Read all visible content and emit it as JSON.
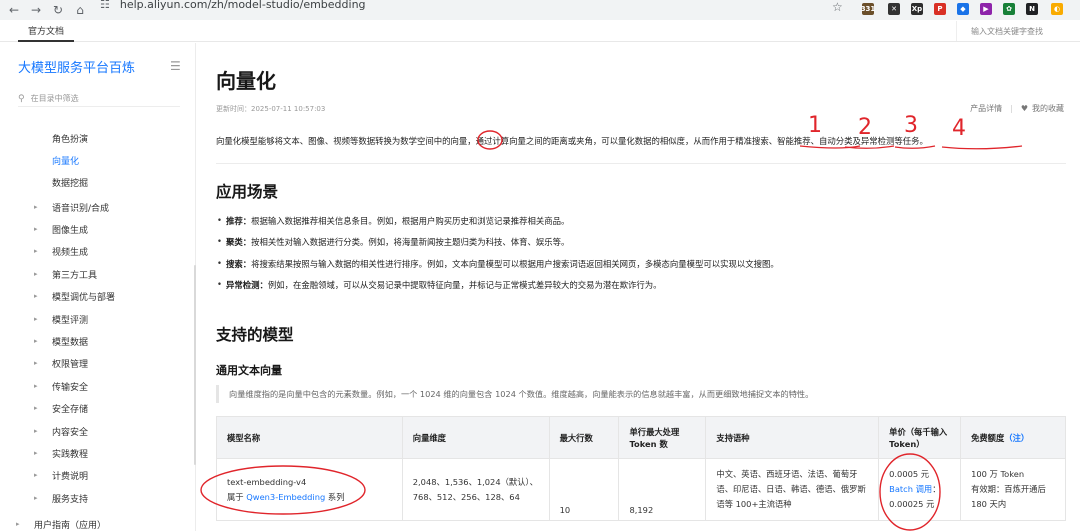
{
  "browser": {
    "url": "help.aliyun.com/zh/model-studio/embedding",
    "ext_badge": "331",
    "extensions": [
      {
        "label": "331",
        "color": "#6b4f2a"
      },
      {
        "label": "✕",
        "color": "#333333"
      },
      {
        "label": "Xp",
        "color": "#2d2d2d"
      },
      {
        "label": "P",
        "color": "#d93025"
      },
      {
        "label": "◆",
        "color": "#1a73e8"
      },
      {
        "label": "▶",
        "color": "#8e24aa"
      },
      {
        "label": "✿",
        "color": "#188038"
      },
      {
        "label": "N",
        "color": "#202124"
      },
      {
        "label": "◐",
        "color": "#f9ab00"
      }
    ]
  },
  "topbar": {
    "tab_label": "官方文档",
    "search_placeholder": "输入文档关键字查找"
  },
  "sidebar": {
    "title": "大模型服务平台百炼",
    "search_placeholder": "在目录中筛选",
    "sub_items": [
      {
        "label": "角色扮演",
        "active": false
      },
      {
        "label": "向量化",
        "active": true
      },
      {
        "label": "数据挖掘",
        "active": false
      }
    ],
    "items": [
      {
        "label": "语音识别/合成"
      },
      {
        "label": "图像生成"
      },
      {
        "label": "视频生成"
      },
      {
        "label": "第三方工具"
      },
      {
        "label": "模型调优与部署"
      },
      {
        "label": "模型评测"
      },
      {
        "label": "模型数据"
      },
      {
        "label": "权限管理"
      },
      {
        "label": "传输安全"
      },
      {
        "label": "安全存储"
      },
      {
        "label": "内容安全"
      },
      {
        "label": "实践教程"
      },
      {
        "label": "计费说明"
      },
      {
        "label": "服务支持"
      }
    ],
    "bottom_item": "用户指南（应用）"
  },
  "page": {
    "title": "向量化",
    "updated": "更新时间：2025-07-11 10:57:03",
    "product_details": "产品详情",
    "my_favorites": "我的收藏",
    "intro": "向量化模型能够将文本、图像、视频等数据转换为数学空间中的向量，通过计算向量之间的距离或夹角，可以量化数据的相似度，从而作用于精准搜索、智能推荐、自动分类及异常检测等任务。",
    "scenarios_title": "应用场景",
    "scenarios": [
      {
        "term": "推荐：",
        "text": "根据输入数据推荐相关信息条目。例如，根据用户购买历史和浏览记录推荐相关商品。"
      },
      {
        "term": "聚类：",
        "text": "按相关性对输入数据进行分类。例如，将海量新闻按主题归类为科技、体育、娱乐等。"
      },
      {
        "term": "搜索：",
        "text": "将搜索结果按照与输入数据的相关性进行排序。例如，文本向量模型可以根据用户搜索词语返回相关网页，多模态向量模型可以实现以文搜图。"
      },
      {
        "term": "异常检测：",
        "text": "例如，在金融领域，可以从交易记录中提取特征向量，并标记与正常模式差异较大的交易为潜在欺诈行为。"
      }
    ],
    "models_title": "支持的模型",
    "general_title": "通用文本向量",
    "dim_note": "向量维度指的是向量中包含的元素数量。例如，一个 1024 维的向量包含 1024 个数值。维度越高，向量能表示的信息就越丰富，从而更细致地捕捉文本的特性。"
  },
  "table": {
    "headers": [
      "模型名称",
      "向量维度",
      "最大行数",
      "单行最大处理Token 数",
      "支持语种",
      "单价（每千输入 Token）",
      "免费额度"
    ],
    "free_quota_link": "（注）",
    "row": {
      "model": "text-embedding-v4",
      "series_prefix": "属于",
      "series_link": "Qwen3-Embedding",
      "series_suffix": "系列",
      "dims": "2,048、1,536、1,024（默认）、768、512、256、128、64",
      "max_rows": "10",
      "max_tokens": "8,192",
      "languages": "中文、英语、西班牙语、法语、葡萄牙语、印尼语、日语、韩语、德语、俄罗斯语等 100+主流语种",
      "price": "0.0005 元",
      "batch_label": "Batch 调用",
      "batch_colon": "：",
      "batch_price": "0.00025 元",
      "free_quota": "100 万 Token",
      "validity": "有效期：百炼开通后 180 天内"
    }
  },
  "annotations": [
    "1",
    "2",
    "3",
    "4"
  ]
}
